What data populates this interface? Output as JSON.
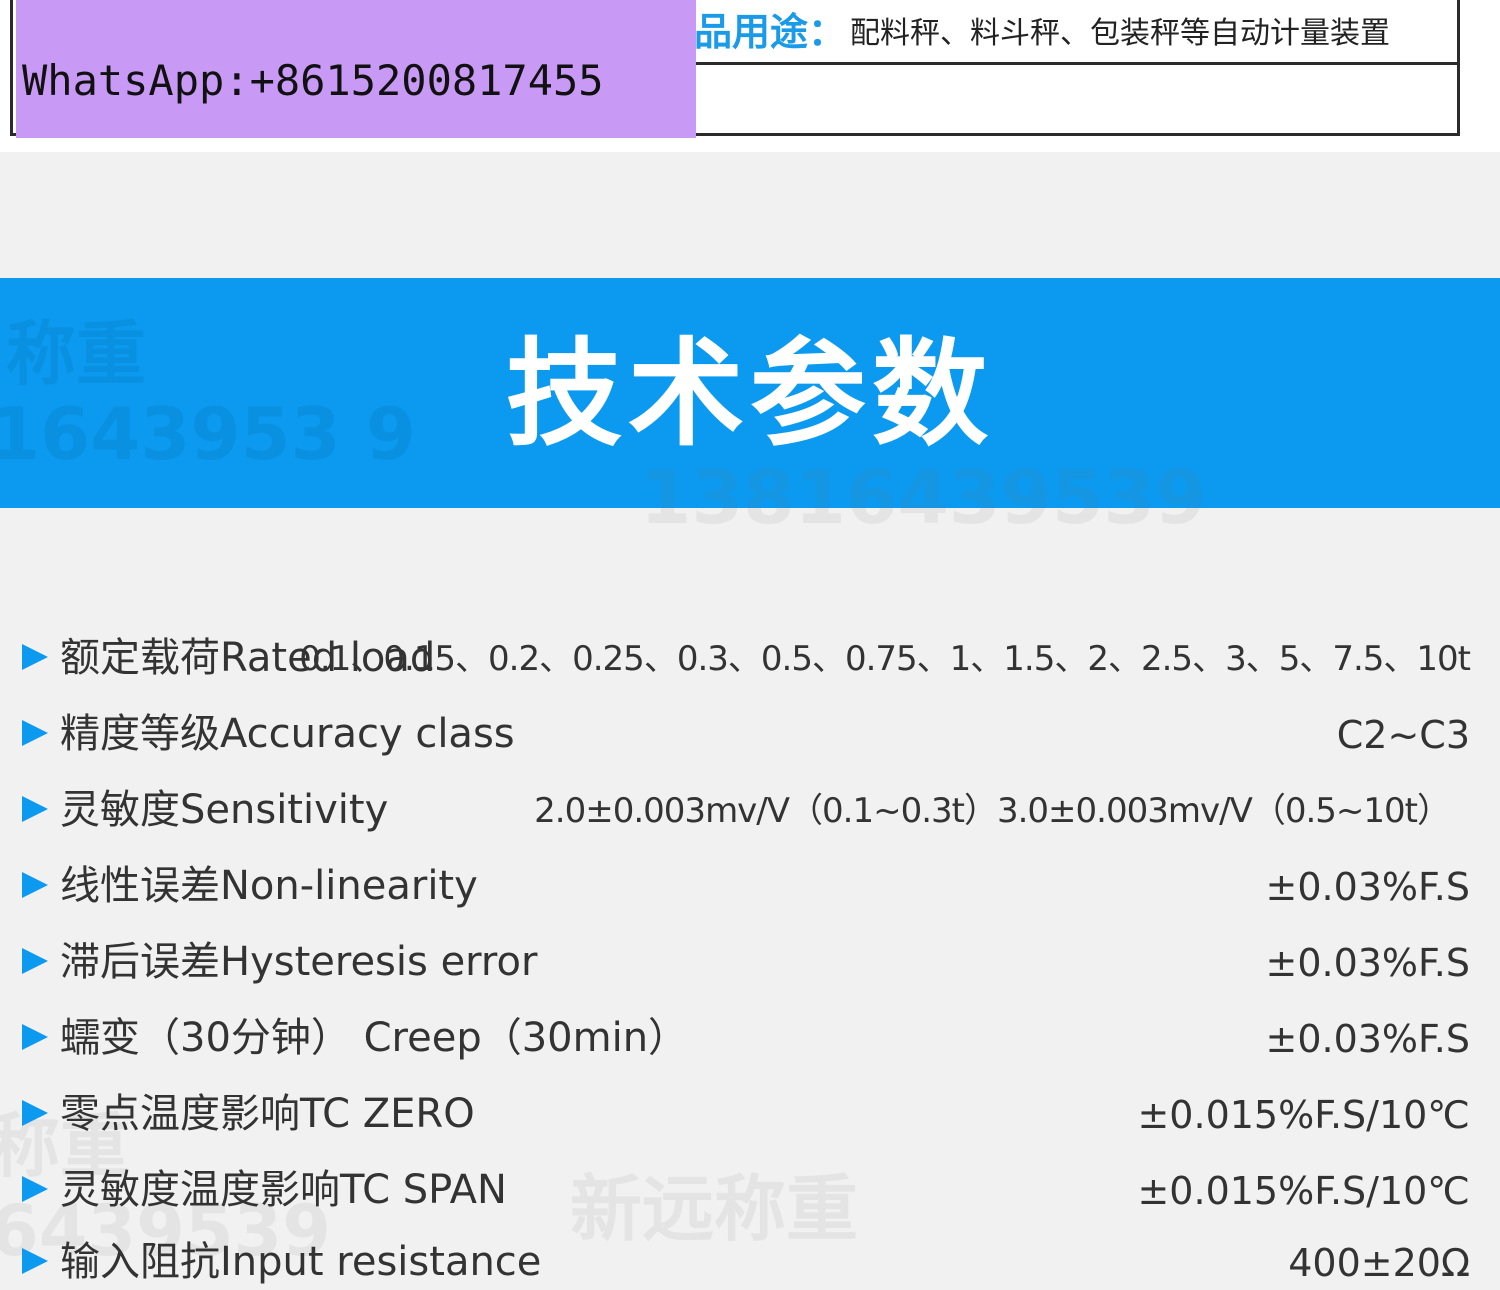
{
  "usage": {
    "label": "品用途：",
    "value": "配料秤、料斗秤、包装秤等自动计量装置"
  },
  "contact": {
    "text": "WhatsApp:+8615200817455"
  },
  "banner": {
    "title": "技术参数"
  },
  "watermarks": {
    "brand_top": "称重",
    "phone_top": "1643953 9",
    "phone_mid": "13816439539",
    "brand_bottom": "新远称重",
    "brand_left": "称重",
    "phone_left": "6439539"
  },
  "specs": [
    {
      "label": "额定载荷Rated load",
      "value": "0.1、0.15、0.2、0.25、0.3、0.5、0.75、1、1.5、2、2.5、3、5、7.5、10t"
    },
    {
      "label": "精度等级Accuracy class",
      "value": "C2~C3"
    },
    {
      "label": "灵敏度Sensitivity",
      "value": "2.0±0.003mv/V（0.1~0.3t）3.0±0.003mv/V（0.5~10t）"
    },
    {
      "label": "线性误差Non-linearity",
      "value": "±0.03%F.S"
    },
    {
      "label": "滞后误差Hysteresis error",
      "value": "±0.03%F.S"
    },
    {
      "label": "蠕变（30分钟） Creep（30min）",
      "value": "±0.03%F.S"
    },
    {
      "label": "零点温度影响TC ZERO",
      "value": "±0.015%F.S/10℃"
    },
    {
      "label": "灵敏度温度影响TC SPAN",
      "value": "±0.015%F.S/10℃"
    },
    {
      "label": "输入阻抗Input resistance",
      "value": "400±20Ω"
    }
  ],
  "colors": {
    "accent": "#0b9af0",
    "contact_badge": "#c89af5",
    "usage_label": "#1b9ae8"
  }
}
